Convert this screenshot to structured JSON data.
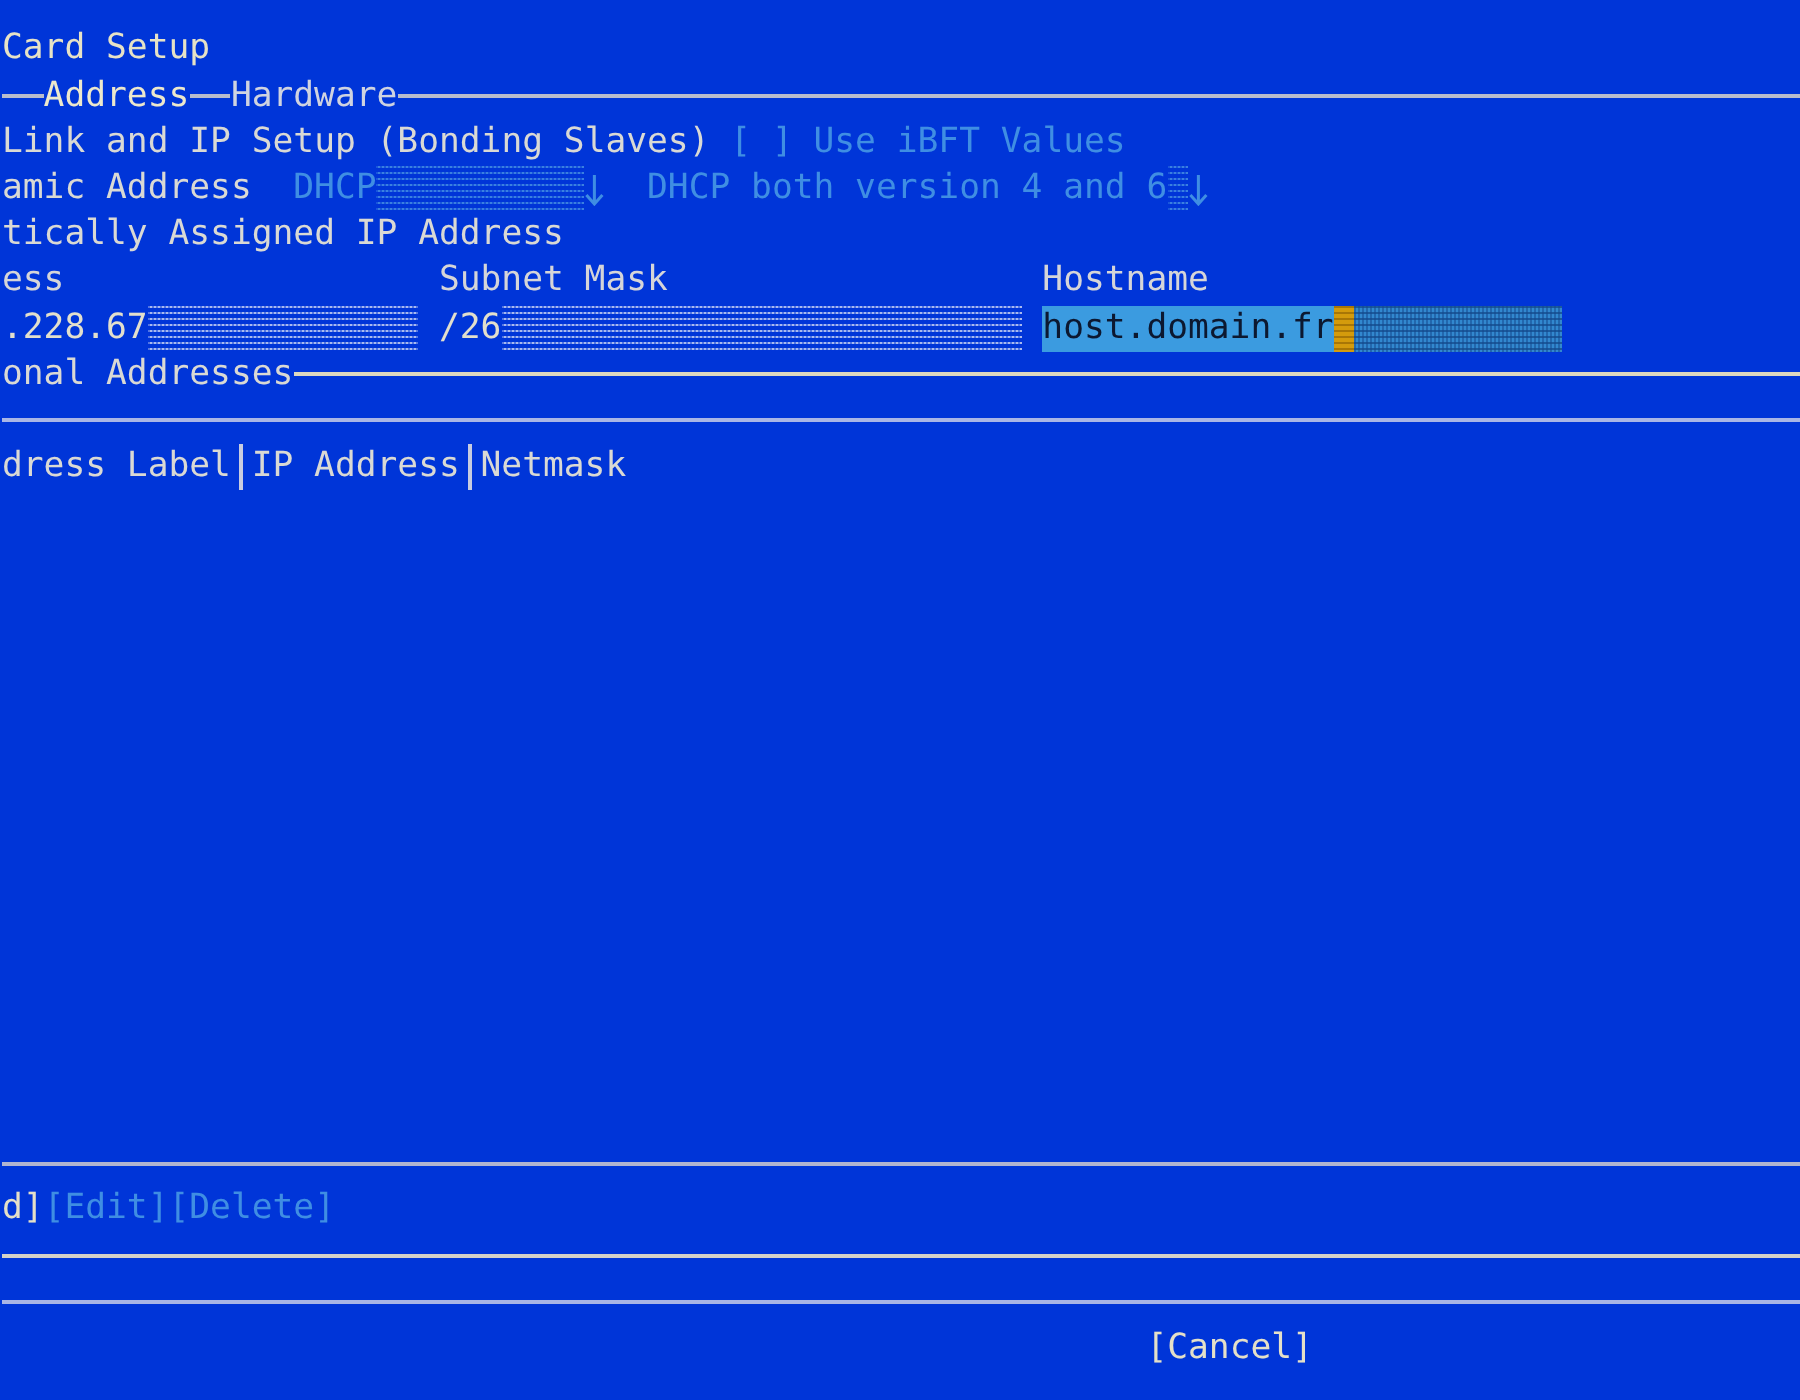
{
  "window": {
    "title": "Card Setup"
  },
  "tabs": [
    {
      "label": "Address",
      "selected": true
    },
    {
      "label": "Hardware",
      "selected": false
    }
  ],
  "link_setup": {
    "label": "Link and IP Setup (Bonding Slaves)"
  },
  "ibft": {
    "box": "[ ]",
    "label": "Use iBFT Values",
    "checked": false,
    "disabled": true
  },
  "dynamic_address": {
    "label": "amic Address",
    "dropdowns": [
      {
        "value": "DHCP",
        "disabled": true
      },
      {
        "value": "DHCP both version 4 and 6",
        "disabled": true
      }
    ]
  },
  "static_address": {
    "label": "tically Assigned IP Address",
    "fields": [
      {
        "label": "ess",
        "value": ".228.67",
        "focused": false
      },
      {
        "label": "Subnet Mask",
        "value": "/26",
        "focused": false
      },
      {
        "label": "Hostname",
        "value": "host.domain.fr",
        "focused": true
      }
    ]
  },
  "additional_addresses": {
    "title": "onal Addresses",
    "table": {
      "columns": [
        "dress Label",
        "IP Address",
        "Netmask"
      ]
    },
    "buttons": [
      {
        "label": "d]",
        "disabled": false
      },
      {
        "label": "[Edit]",
        "disabled": true
      },
      {
        "label": "[Delete]",
        "disabled": true
      }
    ]
  },
  "footer_buttons": [
    {
      "label": "[Cancel]",
      "disabled": false
    }
  ]
}
